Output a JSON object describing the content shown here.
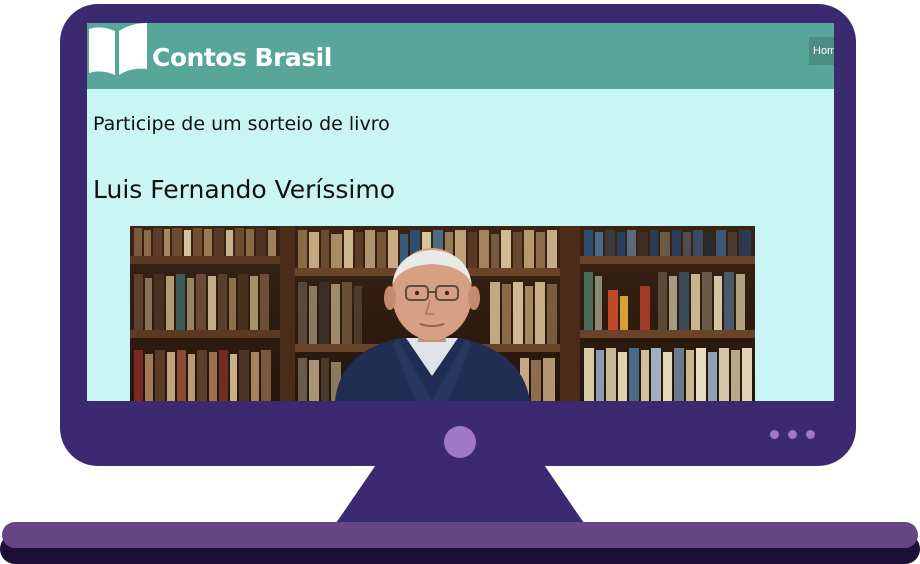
{
  "site": {
    "title": "Contos Brasil",
    "nav_home_label": "Home"
  },
  "content": {
    "giveaway_text": "Participe de um sorteio de livro",
    "author_name": "Luis Fernando Veríssimo"
  },
  "icons": {
    "logo": "open-book-icon",
    "photo": "author-photo",
    "power": "power-button",
    "indicators": "indicator-dots"
  },
  "colors": {
    "monitor": "#3b2a6f",
    "screen_bg": "#c9f5f4",
    "header_bg": "#58a59a",
    "accent": "#a078c4",
    "base": "#664485"
  }
}
